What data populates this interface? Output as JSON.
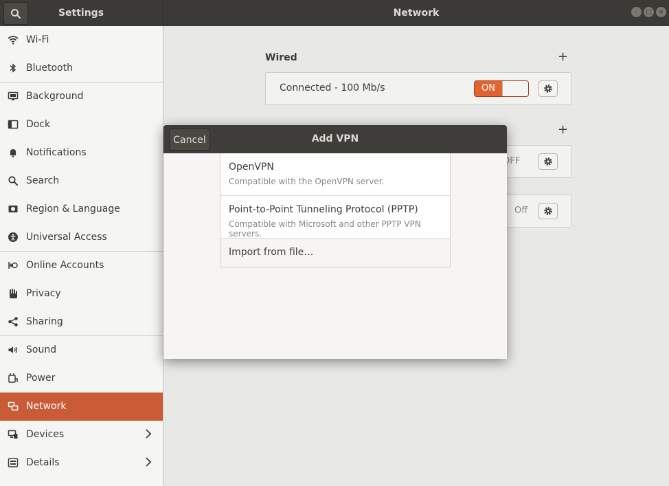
{
  "titlebar": {
    "settings_title": "Settings",
    "panel_title": "Network",
    "search_icon": "search-icon",
    "window_controls": [
      "minimize-icon",
      "maximize-icon",
      "close-icon"
    ]
  },
  "sidebar": {
    "items": [
      {
        "label": "Wi-Fi",
        "icon": "wifi-icon"
      },
      {
        "label": "Bluetooth",
        "icon": "bluetooth-icon"
      },
      {
        "label": "Background",
        "icon": "background-icon"
      },
      {
        "label": "Dock",
        "icon": "dock-icon"
      },
      {
        "label": "Notifications",
        "icon": "bell-icon"
      },
      {
        "label": "Search",
        "icon": "search-icon"
      },
      {
        "label": "Region & Language",
        "icon": "region-icon"
      },
      {
        "label": "Universal Access",
        "icon": "accessibility-icon"
      },
      {
        "label": "Online Accounts",
        "icon": "online-accounts-icon"
      },
      {
        "label": "Privacy",
        "icon": "hand-icon"
      },
      {
        "label": "Sharing",
        "icon": "share-icon"
      },
      {
        "label": "Sound",
        "icon": "speaker-icon"
      },
      {
        "label": "Power",
        "icon": "power-icon"
      },
      {
        "label": "Network",
        "icon": "network-icon"
      },
      {
        "label": "Devices",
        "icon": "devices-icon"
      },
      {
        "label": "Details",
        "icon": "info-icon"
      }
    ],
    "active": "Network",
    "active_color": "#c95b36"
  },
  "main": {
    "wired": {
      "title": "Wired",
      "status": "Connected - 100 Mb/s",
      "toggle_on_label": "ON"
    },
    "vpn_row_toggle_label": "OFF",
    "proxy_row_status": "Off"
  },
  "dialog": {
    "cancel_label": "Cancel",
    "title": "Add VPN",
    "options": [
      {
        "name": "OpenVPN",
        "description": "Compatible with the OpenVPN server."
      },
      {
        "name": "Point-to-Point Tunneling Protocol (PPTP)",
        "description": "Compatible with Microsoft and other PPTP VPN servers."
      }
    ],
    "import_label": "Import from file…"
  },
  "colors": {
    "accent": "#e0642f",
    "titlebar": "#3b3a36"
  }
}
